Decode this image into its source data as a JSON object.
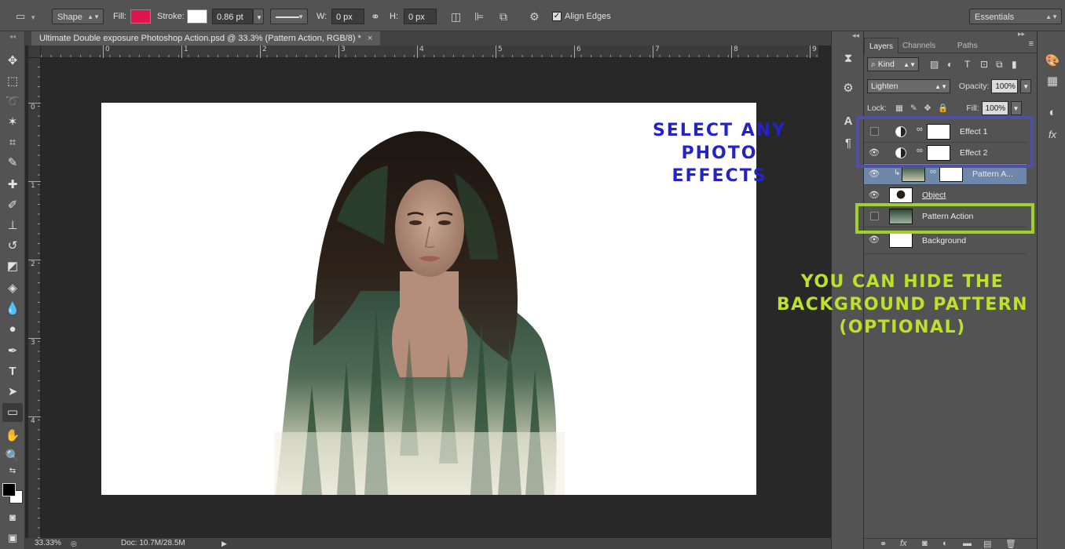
{
  "options_bar": {
    "shape_mode": "Shape",
    "fill_label": "Fill:",
    "fill_color": "#e0154f",
    "stroke_label": "Stroke:",
    "stroke_color": "#ffffff",
    "stroke_width": "0.86 pt",
    "w_label": "W:",
    "w_value": "0 px",
    "h_label": "H:",
    "h_value": "0 px",
    "align_edges_label": "Align Edges",
    "align_edges_checked": true,
    "workspace": "Essentials"
  },
  "document": {
    "tab_title": "Ultimate Double exposure Photoshop Action.psd @ 33.3% (Pattern Action, RGB/8) *",
    "tab_close": "×",
    "ruler_h": [
      "0",
      "1",
      "2",
      "3",
      "4",
      "5",
      "6",
      "7",
      "8",
      "9"
    ],
    "ruler_v": [
      "0",
      "1",
      "2",
      "3",
      "4"
    ]
  },
  "status_bar": {
    "zoom": "33.33%",
    "doc_size": "Doc: 10.7M/28.5M"
  },
  "annotations": {
    "blue_text": "Select any photo effects",
    "blue_color": "#2323c8",
    "green_text": "You can hide the background pattern (optional)",
    "green_color": "#bde02a"
  },
  "layers_panel": {
    "tabs": [
      "Layers",
      "Channels",
      "Paths"
    ],
    "active_tab": "Layers",
    "filter_kind": "Kind",
    "blend_mode": "Lighten",
    "opacity_label": "Opacity:",
    "opacity_value": "100%",
    "lock_label": "Lock:",
    "fill_label": "Fill:",
    "fill_value": "100%",
    "layers": [
      {
        "name": "Effect 1",
        "visible": false,
        "type": "adjustment"
      },
      {
        "name": "Effect 2",
        "visible": true,
        "type": "adjustment"
      },
      {
        "name": "Pattern A...",
        "visible": true,
        "type": "smart",
        "selected": true
      },
      {
        "name": "Object",
        "visible": true,
        "type": "image"
      },
      {
        "name": "Pattern Action",
        "visible": false,
        "type": "image"
      },
      {
        "name": "Background",
        "visible": true,
        "type": "background"
      }
    ]
  }
}
